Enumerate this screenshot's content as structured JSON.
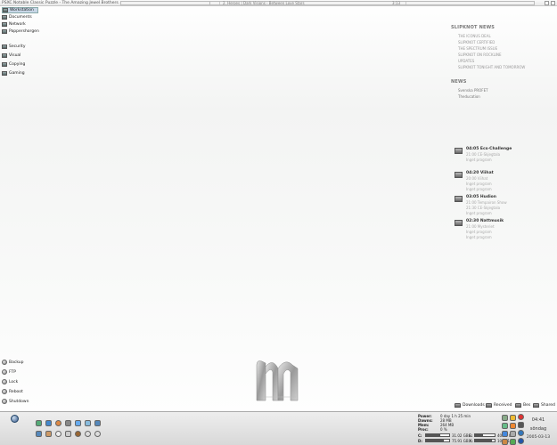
{
  "topbar": {
    "title": "PSXC Notable Classic Puzzle - The Amazing Jewel Brothers",
    "song": "2. Heroes | Dark Visions - Between Love Stars",
    "time": "3:13"
  },
  "menu_top": [
    {
      "label": "Workstation",
      "icon": "computer-icon"
    },
    {
      "label": "Documents",
      "icon": "folder-icon"
    },
    {
      "label": "Network",
      "icon": "network-icon"
    },
    {
      "label": "Pappershorgen",
      "icon": "recycle-bin-icon"
    }
  ],
  "menu_mid": [
    {
      "label": "Security",
      "icon": "shield-icon"
    },
    {
      "label": "Visual",
      "icon": "monitor-icon"
    },
    {
      "label": "Copying",
      "icon": "copy-icon"
    },
    {
      "label": "Gaming",
      "icon": "gamepad-icon"
    }
  ],
  "news": {
    "heading": "SLIPKNOT NEWS",
    "items": [
      "THE ICONUS DEAL",
      "SLIPKNOT CERTIFIED",
      "THE SPECTRUM ISSUE",
      "SLIPKNOT ON ROCKLINE",
      "UPDATES",
      "SLIPKNOT TONIGHT AND TOMORROW"
    ]
  },
  "news2": {
    "heading": "NEWS",
    "items": [
      "Svenska PROFET",
      "Theducation"
    ]
  },
  "calendar": [
    {
      "title": "04:05 Ecs-Challenge",
      "lines": [
        "21:00 CE-Skjegtala",
        "Inget program"
      ]
    },
    {
      "title": "04:20 Viihat",
      "lines": [
        "20:00 Viihat",
        "Inget program",
        "Inget program"
      ]
    },
    {
      "title": "03:05 Hudion",
      "lines": [
        "21:00 Tempairon Show",
        "21:30 CE-Skjegtala",
        "Inget program"
      ]
    },
    {
      "title": "02:30 Nattmusik",
      "lines": [
        "21:00 Mysteriet",
        "Inget program",
        "Inget program"
      ]
    }
  ],
  "actions": [
    {
      "label": "Backup",
      "icon": "backup-icon"
    },
    {
      "label": "FTP",
      "icon": "ftp-icon"
    },
    {
      "label": "Lock",
      "icon": "lock-icon"
    },
    {
      "label": "Reboot",
      "icon": "reboot-icon"
    },
    {
      "label": "Shutdown",
      "icon": "power-icon"
    }
  ],
  "folders": [
    {
      "label": "Downloads",
      "icon": "downloads-folder-icon"
    },
    {
      "label": "Received",
      "icon": "received-folder-icon"
    },
    {
      "label": "Bes",
      "icon": "bes-folder-icon"
    },
    {
      "label": "Shared",
      "icon": "shared-folder-icon"
    }
  ],
  "sysinfo": {
    "rows": [
      {
        "label": "Power:",
        "value": "0 day 1 h 25 min"
      },
      {
        "label": "Dawns:",
        "value": "28 MB"
      },
      {
        "label": "Mem:",
        "value": "264 MB"
      },
      {
        "label": "Proc:",
        "value": "0 %"
      }
    ],
    "drives": [
      {
        "label": "C:",
        "value": "31.02 GB",
        "fill": 0.6
      },
      {
        "label": "D:",
        "value": "75.91 GB",
        "fill": 0.75
      },
      {
        "label": "E:",
        "value": "40.42 GB",
        "fill": 0.4
      },
      {
        "label": "X:",
        "value": "105.01 GB",
        "fill": 0.85
      }
    ]
  },
  "clock": {
    "time": "04:41",
    "weekday": "söndag",
    "date": "2005-03-13"
  }
}
